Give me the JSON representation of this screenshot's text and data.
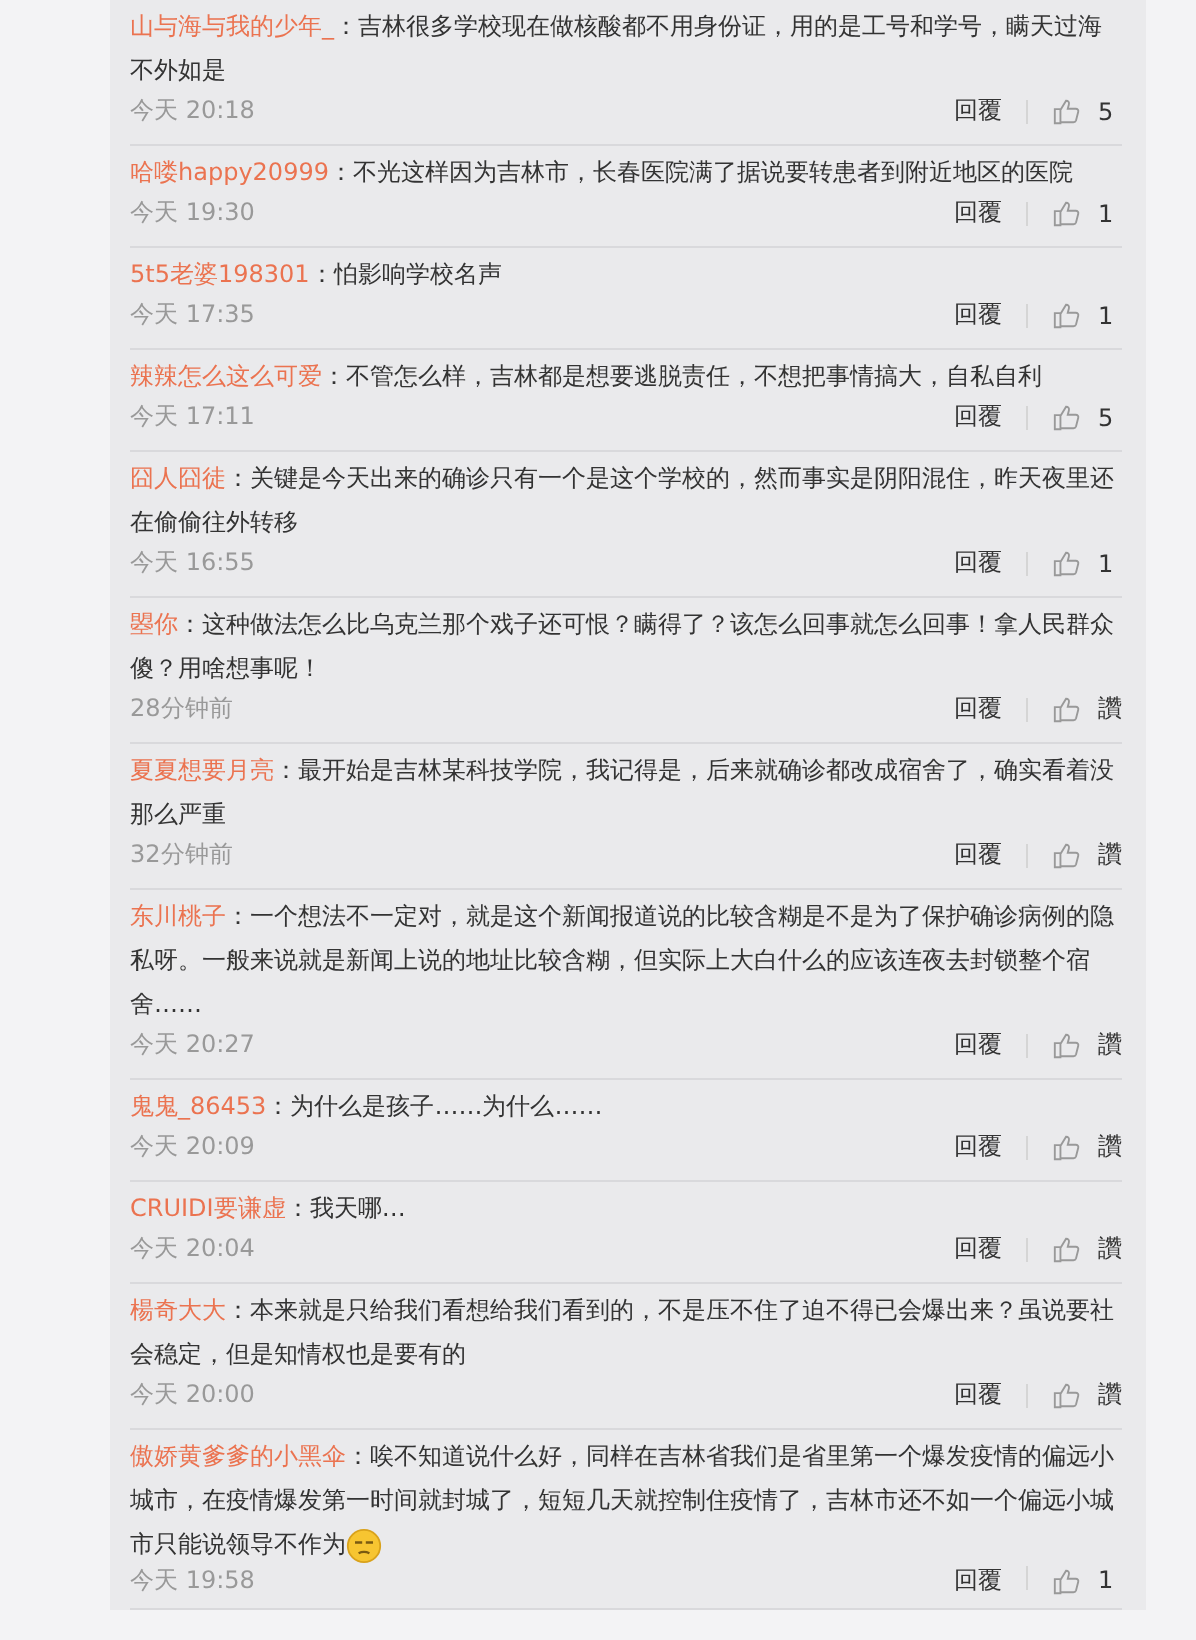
{
  "comments": [
    {
      "user": "山与海与我的少年_",
      "text": "：吉林很多学校现在做核酸都不用身份证，用的是工号和学号，瞒天过海不外如是",
      "time": "今天 20:18",
      "reply": "回覆",
      "likes": "5"
    },
    {
      "user": "哈喽happy20999",
      "text": "：不光这样因为吉林市，长春医院满了据说要转患者到附近地区的医院",
      "time": "今天 19:30",
      "reply": "回覆",
      "likes": "1"
    },
    {
      "user": "5t5老婆198301",
      "text": "：怕影响学校名声",
      "time": "今天 17:35",
      "reply": "回覆",
      "likes": "1"
    },
    {
      "user": "辣辣怎么这么可爱",
      "text": "：不管怎么样，吉林都是想要逃脱责任，不想把事情搞大，自私自利",
      "time": "今天 17:11",
      "reply": "回覆",
      "likes": "5"
    },
    {
      "user": "囧人囧徒",
      "text": "：关键是今天出来的确诊只有一个是这个学校的，然而事实是阴阳混住，昨天夜里还在偷偷往外转移",
      "time": "今天 16:55",
      "reply": "回覆",
      "likes": "1"
    },
    {
      "user": "曌你",
      "text": "：这种做法怎么比乌克兰那个戏子还可恨？瞒得了？该怎么回事就怎么回事！拿人民群众傻？用啥想事呢！",
      "time": "28分钟前",
      "reply": "回覆",
      "likes": "讚"
    },
    {
      "user": "夏夏想要月亮",
      "text": "：最开始是吉林某科技学院，我记得是，后来就确诊都改成宿舍了，确实看着没那么严重",
      "time": "32分钟前",
      "reply": "回覆",
      "likes": "讚"
    },
    {
      "user": "东川桃子",
      "text": "：一个想法不一定对，就是这个新闻报道说的比较含糊是不是为了保护确诊病例的隐私呀。一般来说就是新闻上说的地址比较含糊，但实际上大白什么的应该连夜去封锁整个宿舍……",
      "time": "今天 20:27",
      "reply": "回覆",
      "likes": "讚"
    },
    {
      "user": "鬼鬼_86453",
      "text": "：为什么是孩子……为什么……",
      "time": "今天 20:09",
      "reply": "回覆",
      "likes": "讚"
    },
    {
      "user": "CRUIDI要谦虚",
      "text": "：我天哪…",
      "time": "今天 20:04",
      "reply": "回覆",
      "likes": "讚"
    },
    {
      "user": "楊奇大大",
      "text": "：本来就是只给我们看想给我们看到的，不是压不住了迫不得已会爆出来？虽说要社会稳定，但是知情权也是要有的",
      "time": "今天 20:00",
      "reply": "回覆",
      "likes": "讚"
    },
    {
      "user": "傲娇黄爹爹的小黑伞",
      "text": "：唉不知道说什么好，同样在吉林省我们是省里第一个爆发疫情的偏远小城市，在疫情爆发第一时间就封城了，短短几天就控制住疫情了，吉林市还不如一个偏远小城市只能说领导不作为",
      "emoji": true,
      "time": "今天 19:58",
      "reply": "回覆",
      "likes": "1"
    }
  ]
}
